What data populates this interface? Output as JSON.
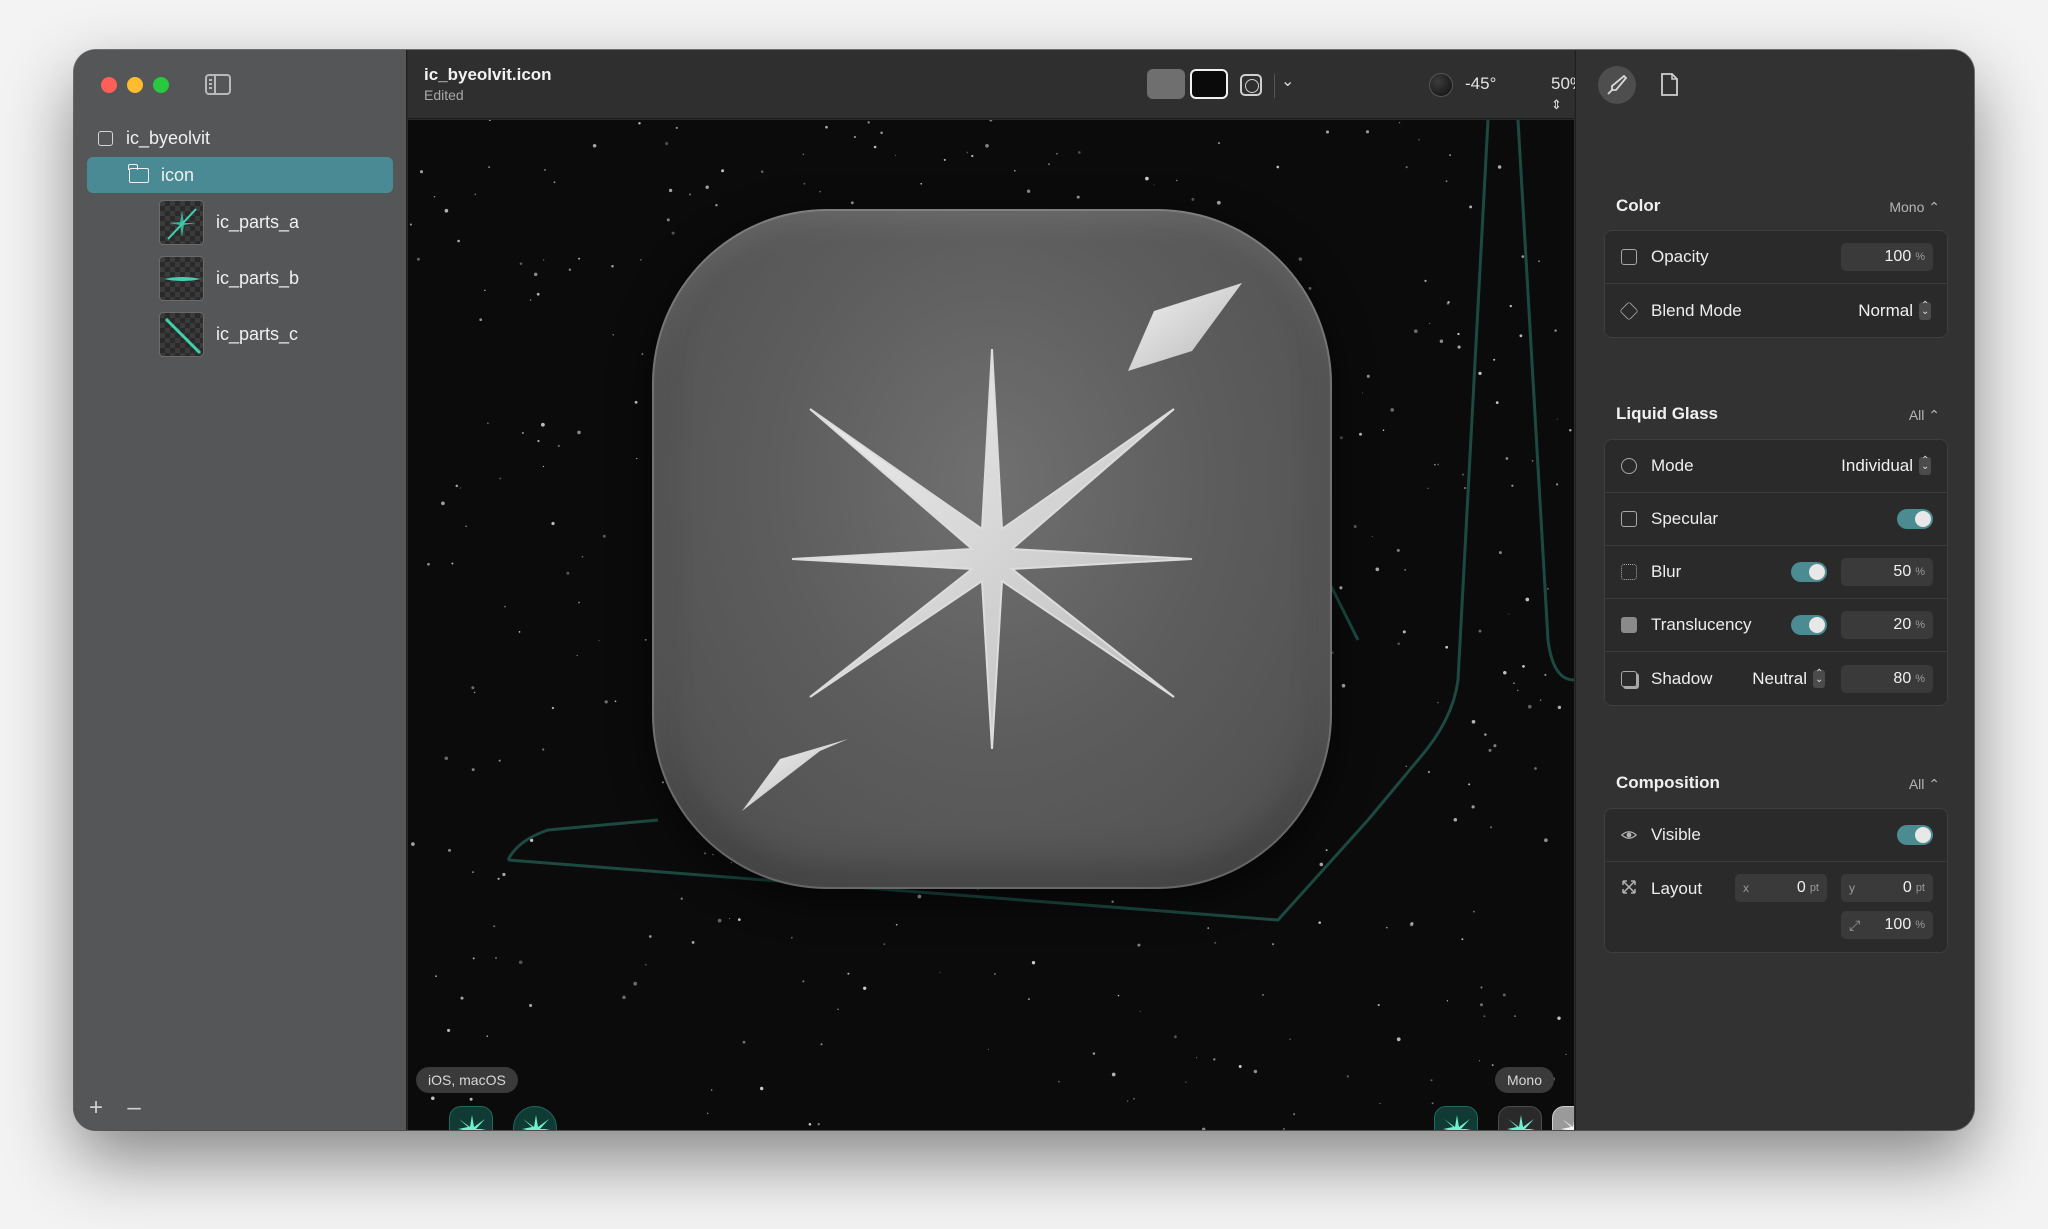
{
  "sidebar": {
    "root": "ic_byeolvit",
    "folder": "icon",
    "parts": [
      "ic_parts_a",
      "ic_parts_b",
      "ic_parts_c"
    ],
    "add_label": "+",
    "remove_label": "–"
  },
  "toolbar": {
    "title": "ic_byeolvit.icon",
    "subtitle": "Edited",
    "light_angle": "-45°",
    "zoom": "50%"
  },
  "canvas": {
    "platform_label": "iOS, macOS",
    "appearance_label": "Mono"
  },
  "inspector": {
    "color": {
      "title": "Color",
      "mode": "Mono ⌃",
      "opacity_label": "Opacity",
      "opacity_value": "100",
      "opacity_unit": "%",
      "blend_label": "Blend Mode",
      "blend_value": "Normal"
    },
    "liquid_glass": {
      "title": "Liquid Glass",
      "scope": "All ⌃",
      "mode_label": "Mode",
      "mode_value": "Individual",
      "specular_label": "Specular",
      "specular_on": true,
      "blur_label": "Blur",
      "blur_on": true,
      "blur_value": "50",
      "blur_unit": "%",
      "translucency_label": "Translucency",
      "translucency_on": true,
      "translucency_value": "20",
      "translucency_unit": "%",
      "shadow_label": "Shadow",
      "shadow_type": "Neutral",
      "shadow_value": "80",
      "shadow_unit": "%"
    },
    "composition": {
      "title": "Composition",
      "scope": "All ⌃",
      "visible_label": "Visible",
      "visible_on": true,
      "layout_label": "Layout",
      "x_axis": "x",
      "x_value": "0",
      "x_unit": "pt",
      "y_axis": "y",
      "y_value": "0",
      "y_unit": "pt",
      "scale_value": "100",
      "scale_unit": "%"
    }
  },
  "colors": {
    "accent": "#4a8a94",
    "sidebar_bg": "#555657",
    "canvas_bg": "#0b0b0b",
    "inspector_bg": "#323232"
  }
}
